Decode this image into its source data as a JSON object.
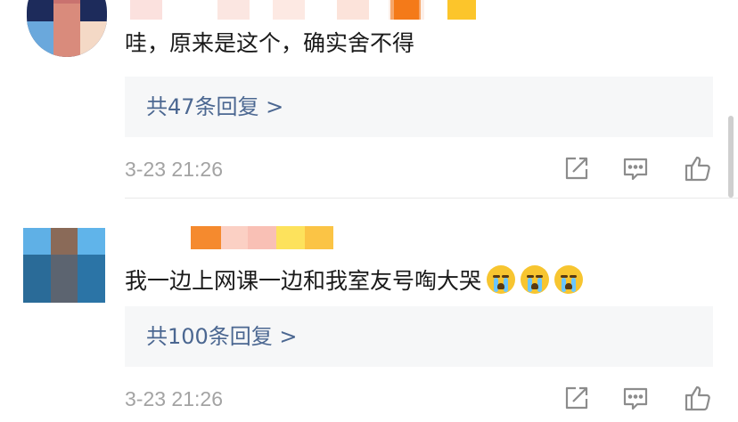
{
  "comments": [
    {
      "text": "哇，原来是这个，确实舍不得",
      "replies_label": "共47条回复 >",
      "timestamp": "3-23 21:26"
    },
    {
      "text": "我一边上网课一边和我室友号啕大哭",
      "emoji": "loudly-crying-face",
      "replies_label": "共100条回复 >",
      "timestamp": "3-23 21:26"
    }
  ],
  "colors": {
    "reply_link": "#4b6791",
    "timestamp": "#a3a3a3",
    "reply_box_bg": "#f6f7f8"
  },
  "icons": [
    "share-icon",
    "comment-icon",
    "like-icon"
  ]
}
